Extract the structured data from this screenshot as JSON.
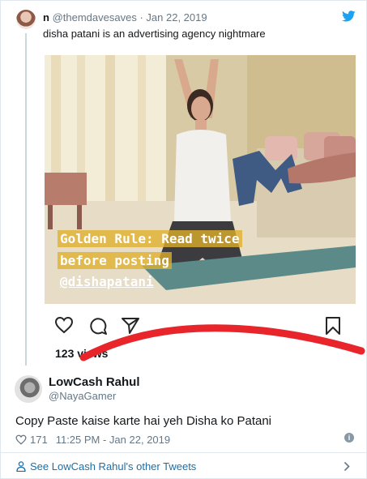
{
  "quoted_tweet": {
    "name": "n",
    "handle": "@themdavesaves",
    "separator": "·",
    "date": "Jan 22, 2019",
    "text": "disha patani is an advertising agency nightmare",
    "media": {
      "caption_line1": "Golden Rule: Read twice",
      "caption_line2": "before posting",
      "caption_mention": "@dishapatani",
      "views": "123 views"
    }
  },
  "reply_tweet": {
    "name": "LowCash Rahul",
    "handle": "@NayaGamer",
    "text": "Copy Paste kaise karte hai yeh Disha ko Patani",
    "likes": "171",
    "timestamp": "11:25 PM - Jan 22, 2019"
  },
  "footer": {
    "see_more_label": "See LowCash Rahul's other Tweets"
  },
  "colors": {
    "twitter_blue": "#1da1f2",
    "link_blue": "#1b6fa8",
    "secondary_text": "#657786",
    "annotation_red": "#e8252b",
    "caption_highlight": "#e0b02a"
  },
  "icons": {
    "brand": "twitter-bird-icon",
    "instagram_actions": [
      "heart-icon",
      "comment-icon",
      "share-icon",
      "bookmark-icon"
    ],
    "reply_meta": [
      "heart-icon",
      "info-icon"
    ],
    "footer": [
      "person-icon",
      "chevron-right-icon"
    ]
  }
}
